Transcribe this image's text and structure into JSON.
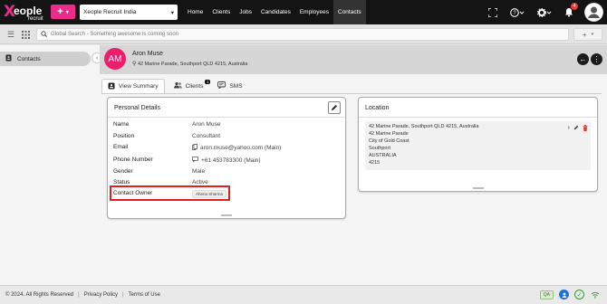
{
  "brand": {
    "x": "X",
    "name": "eople",
    "sub": "recruit"
  },
  "topbar": {
    "add_label": "+",
    "add_caret": "▾",
    "company": "Xeople Recruit India",
    "company_caret": "▾",
    "nav": [
      "Home",
      "Clients",
      "Jobs",
      "Candidates",
      "Employees",
      "Contacts"
    ],
    "active_nav": "Contacts",
    "notification_count": "4",
    "icons": [
      "fullscreen-icon",
      "help-icon",
      "settings-icon",
      "bell-icon",
      "user-icon"
    ]
  },
  "search": {
    "placeholder": "Global Search - Something awesome is coming soon"
  },
  "sidebar": {
    "item": "Contacts"
  },
  "contact": {
    "initials": "AM",
    "name": "Aron Muse",
    "address": "42 Marine Parade, Southport QLD 4215, Australia"
  },
  "tabs": {
    "summary": "View Summary",
    "clients": "Clients",
    "clients_count": "1",
    "sms": "SMS"
  },
  "personal": {
    "title": "Personal Details",
    "rows": [
      {
        "label": "Name",
        "value": "Aron Muse"
      },
      {
        "label": "Position",
        "value": "Consultant"
      },
      {
        "label": "Email",
        "value": "aron.muse@yahoo.com (Main)"
      },
      {
        "label": "Phone Number",
        "value": "+61 453783300 (Main)"
      },
      {
        "label": "Gender",
        "value": "Male"
      },
      {
        "label": "Status",
        "value": "Active"
      },
      {
        "label": "Contact Owner",
        "value": "Aheria Sharma"
      }
    ]
  },
  "location": {
    "title": "Location",
    "lines": [
      "42 Marine Parade, Southport QLD 4215, Australia",
      "42 Marine Parade",
      "City of Gold Coast",
      "Southport",
      "AUSTRALIA",
      "4215"
    ]
  },
  "footer": {
    "copyright": "© 2024. All Rights Reserved",
    "sep": "|",
    "privacy": "Privacy Policy",
    "terms": "Terms of Use",
    "qa": "QA"
  }
}
